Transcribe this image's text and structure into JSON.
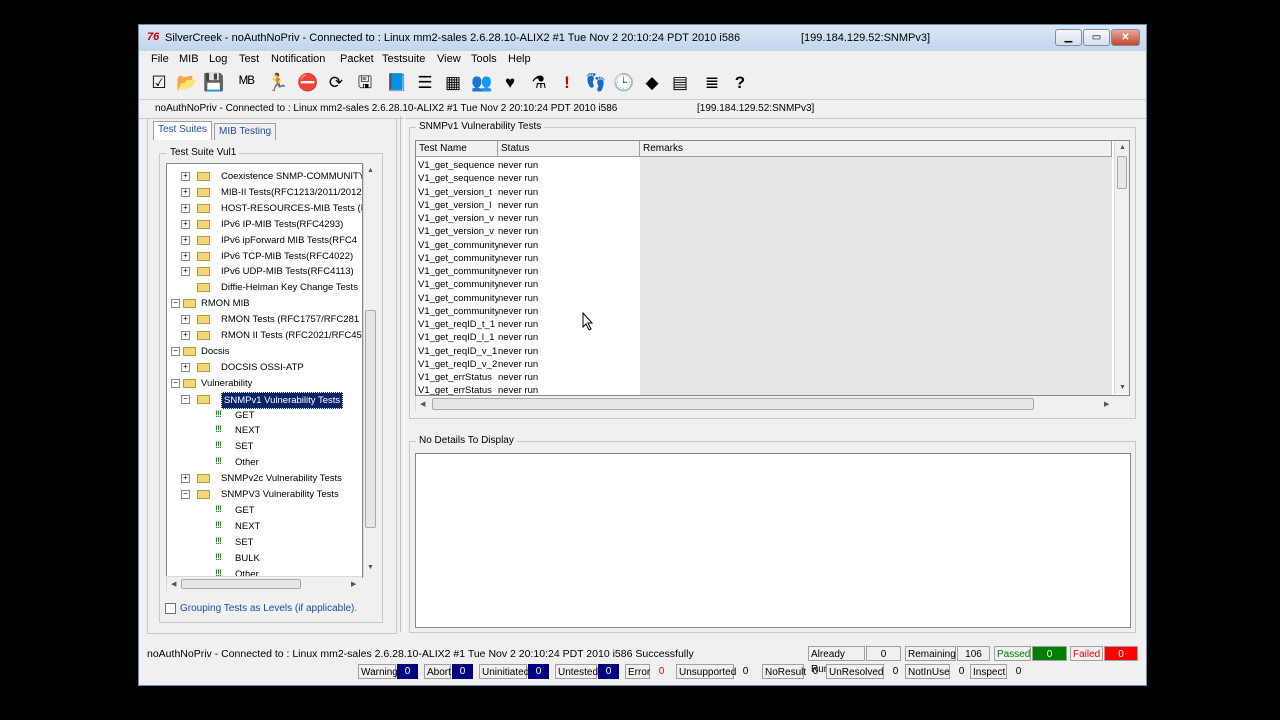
{
  "window": {
    "title": "SilverCreek - noAuthNoPriv - Connected to : Linux mm2-sales 2.6.28.10-ALIX2 #1 Tue Nov 2 20:10:24 PDT 2010 i586",
    "address": "[199.184.129.52:SNMPv3]",
    "app_icon": "76"
  },
  "menu": [
    "File",
    "MIB",
    "Log",
    "Test",
    "Notification",
    "Packet",
    "Testsuite",
    "View",
    "Tools",
    "Help"
  ],
  "toolbar_icons": [
    "checkbox-icon",
    "folder-open-icon",
    "save-icon",
    "mibs-icon",
    "run-icon",
    "stop-icon",
    "reload-icon",
    "disk-icon",
    "book-icon",
    "list-icon",
    "table-icon",
    "group-icon",
    "badge-icon",
    "flask-icon",
    "alert-icon",
    "footprint-icon",
    "clock-icon",
    "sign-icon",
    "grid-icon",
    "log-icon",
    "help-icon"
  ],
  "connection": {
    "text": "noAuthNoPriv - Connected to : Linux mm2-sales 2.6.28.10-ALIX2 #1 Tue Nov 2 20:10:24 PDT 2010 i586",
    "address": "[199.184.129.52:SNMPv3]"
  },
  "tabs": [
    "Test Suites",
    "MIB Testing"
  ],
  "suite_group": "Test Suite Vul1",
  "tree": [
    {
      "label": "Coexistence SNMP-COMMUNITY",
      "kind": "folder-tests",
      "level": 2,
      "exp": "+"
    },
    {
      "label": "MIB-II Tests(RFC1213/2011/2012",
      "kind": "folder-tests",
      "level": 2,
      "exp": "+"
    },
    {
      "label": "HOST-RESOURCES-MIB Tests (R",
      "kind": "folder-tests",
      "level": 2,
      "exp": "+"
    },
    {
      "label": "IPv6 IP-MIB Tests(RFC4293)",
      "kind": "folder-tests",
      "level": 2,
      "exp": "+"
    },
    {
      "label": "IPv6 ipForward MIB Tests(RFC4",
      "kind": "folder-tests",
      "level": 2,
      "exp": "+"
    },
    {
      "label": "IPv6 TCP-MIB Tests(RFC4022)",
      "kind": "folder-tests",
      "level": 2,
      "exp": "+"
    },
    {
      "label": "IPv6 UDP-MIB Tests(RFC4113)",
      "kind": "folder-tests",
      "level": 2,
      "exp": "+"
    },
    {
      "label": "Diffie-Helman Key Change Tests",
      "kind": "folder-tests",
      "level": 2,
      "exp": ""
    },
    {
      "label": "RMON MIB",
      "kind": "folder",
      "level": 1,
      "exp": "-"
    },
    {
      "label": "RMON Tests (RFC1757/RFC281",
      "kind": "folder-tests",
      "level": 2,
      "exp": "+"
    },
    {
      "label": "RMON II Tests (RFC2021/RFC45",
      "kind": "folder-tests",
      "level": 2,
      "exp": "+"
    },
    {
      "label": "Docsis",
      "kind": "folder",
      "level": 1,
      "exp": "-"
    },
    {
      "label": "DOCSIS OSSI-ATP",
      "kind": "folder-tests",
      "level": 2,
      "exp": "+"
    },
    {
      "label": "Vulnerability",
      "kind": "folder",
      "level": 1,
      "exp": "-"
    },
    {
      "label": "SNMPv1 Vulnerability Tests",
      "kind": "folder-tests",
      "level": 2,
      "exp": "-",
      "selected": true
    },
    {
      "label": "GET",
      "kind": "leaf",
      "level": 3,
      "exp": ""
    },
    {
      "label": "NEXT",
      "kind": "leaf",
      "level": 3,
      "exp": ""
    },
    {
      "label": "SET",
      "kind": "leaf",
      "level": 3,
      "exp": ""
    },
    {
      "label": "Other",
      "kind": "leaf",
      "level": 3,
      "exp": ""
    },
    {
      "label": "SNMPv2c Vulnerability Tests",
      "kind": "folder-tests",
      "level": 2,
      "exp": "+"
    },
    {
      "label": "SNMPV3 Vulnerability Tests",
      "kind": "folder-tests",
      "level": 2,
      "exp": "-"
    },
    {
      "label": "GET",
      "kind": "leaf",
      "level": 3,
      "exp": ""
    },
    {
      "label": "NEXT",
      "kind": "leaf",
      "level": 3,
      "exp": ""
    },
    {
      "label": "SET",
      "kind": "leaf",
      "level": 3,
      "exp": ""
    },
    {
      "label": "BULK",
      "kind": "leaf",
      "level": 3,
      "exp": ""
    },
    {
      "label": "Other",
      "kind": "leaf",
      "level": 3,
      "exp": ""
    }
  ],
  "grouping_checkbox": "Grouping Tests as Levels (if applicable).",
  "tests_group": "SNMPv1 Vulnerability Tests",
  "columns": [
    "Test Name",
    "Status",
    "Remarks"
  ],
  "rows": [
    {
      "name": "V1_get_sequence",
      "status": "never run"
    },
    {
      "name": "V1_get_sequence",
      "status": "never run"
    },
    {
      "name": "V1_get_version_t",
      "status": "never run"
    },
    {
      "name": "V1_get_version_l",
      "status": "never run"
    },
    {
      "name": "V1_get_version_v",
      "status": "never run"
    },
    {
      "name": "V1_get_version_v",
      "status": "never run"
    },
    {
      "name": "V1_get_community",
      "status": "never run"
    },
    {
      "name": "V1_get_community",
      "status": "never run"
    },
    {
      "name": "V1_get_community",
      "status": "never run"
    },
    {
      "name": "V1_get_community",
      "status": "never run"
    },
    {
      "name": "V1_get_community",
      "status": "never run"
    },
    {
      "name": "V1_get_community",
      "status": "never run"
    },
    {
      "name": "V1_get_reqID_t_1",
      "status": "never run"
    },
    {
      "name": "V1_get_reqID_l_1",
      "status": "never run"
    },
    {
      "name": "V1_get_reqID_v_1",
      "status": "never run"
    },
    {
      "name": "V1_get_reqID_v_2",
      "status": "never run"
    },
    {
      "name": "V1_get_errStatus",
      "status": "never run"
    },
    {
      "name": "V1_get_errStatus",
      "status": "never run"
    }
  ],
  "details_group": "No Details To Display",
  "status": {
    "message": "noAuthNoPriv - Connected to : Linux mm2-sales 2.6.28.10-ALIX2 #1 Tue Nov 2 20:10:24 PDT 2010 i586 Successfully",
    "already_run_label": "Already Run",
    "already_run": "0",
    "remaining_label": "Remaining",
    "remaining": "106",
    "passed_label": "Passed",
    "passed": "0",
    "failed_label": "Failed",
    "failed": "0",
    "counters": [
      {
        "label": "Warning",
        "value": "0",
        "style": "blue"
      },
      {
        "label": "Abort",
        "value": "0",
        "style": "blue"
      },
      {
        "label": "Uninitiated",
        "value": "0",
        "style": "blue"
      },
      {
        "label": "Untested",
        "value": "0",
        "style": "blue"
      },
      {
        "label": "Error",
        "value": "0",
        "style": "red"
      },
      {
        "label": "Unsupported",
        "value": "0",
        "style": "plain"
      },
      {
        "label": "NoResult",
        "value": "0",
        "style": "plain"
      },
      {
        "label": "UnResolved",
        "value": "0",
        "style": "plain"
      },
      {
        "label": "NotInUse",
        "value": "0",
        "style": "plain"
      },
      {
        "label": "Inspect",
        "value": "0",
        "style": "plain"
      }
    ]
  },
  "colors": {
    "selection": "#0a246a",
    "passed_bg": "#008000",
    "failed_bg": "#ff0000",
    "counter_blue": "#000080",
    "passed_text": "#008000",
    "failed_text": "#ff0000"
  }
}
